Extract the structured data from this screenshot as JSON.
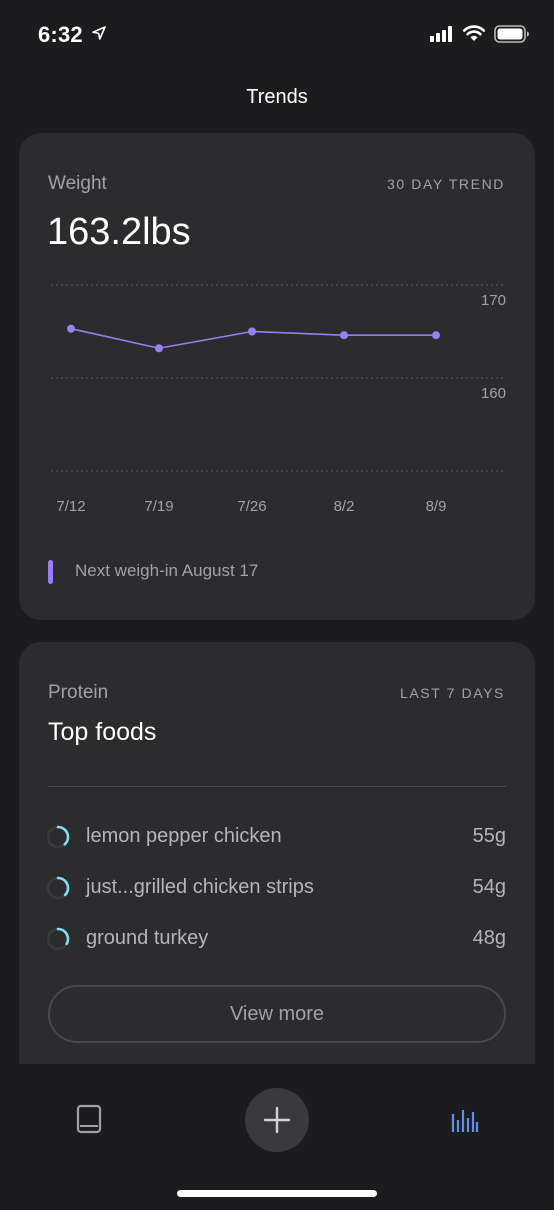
{
  "status_bar": {
    "time": "6:32",
    "icons": [
      "location-arrow-icon",
      "cellular-signal-icon",
      "wifi-icon",
      "battery-icon"
    ]
  },
  "header": {
    "title": "Trends"
  },
  "weight_card": {
    "label": "Weight",
    "tag": "30 DAY TREND",
    "value": "163.2lbs",
    "next_weigh_in": "Next weigh-in August 17",
    "accent_color": "#9b7ff2"
  },
  "chart_data": {
    "type": "line",
    "categories": [
      "7/12",
      "7/19",
      "7/26",
      "8/2",
      "8/9"
    ],
    "series": [
      {
        "values": [
          165.3,
          163.2,
          165.0,
          164.6,
          164.6
        ]
      }
    ],
    "y_ticks": [
      "170",
      "160"
    ],
    "ylim": [
      150,
      172
    ],
    "grid": true,
    "color": "#9b7ff2"
  },
  "protein_card": {
    "label": "Protein",
    "tag": "LAST 7 DAYS",
    "title": "Top foods",
    "ring_color": "#7ee0f0",
    "foods": [
      {
        "name": "lemon pepper chicken",
        "amount": "55g",
        "share": 0.38
      },
      {
        "name": "just...grilled chicken strips",
        "amount": "54g",
        "share": 0.37
      },
      {
        "name": "ground turkey",
        "amount": "48g",
        "share": 0.33
      }
    ],
    "view_more": "View more"
  },
  "tab_bar": {
    "items": [
      "book-icon",
      "plus-icon",
      "bar-chart-icon"
    ],
    "active": "bar-chart-icon",
    "active_color": "#5b8ff0"
  }
}
